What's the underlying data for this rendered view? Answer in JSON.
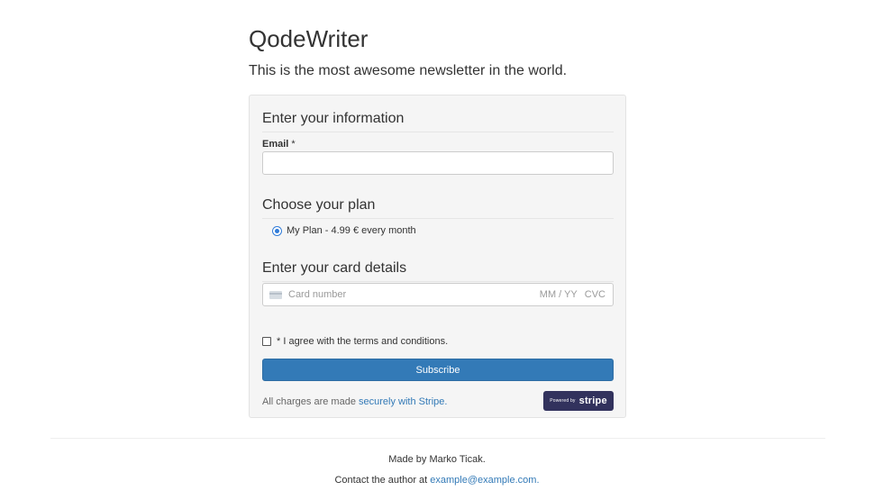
{
  "header": {
    "title": "QodeWriter",
    "tagline": "This is the most awesome newsletter in the world."
  },
  "form": {
    "info_heading": "Enter your information",
    "email_label": "Email",
    "required_mark": "*",
    "email_value": "",
    "plan_heading": "Choose your plan",
    "plan_option": "My Plan - 4.99 € every month",
    "plan_selected": true,
    "card_heading": "Enter your card details",
    "card_placeholder": "Card number",
    "card_expiry_placeholder": "MM / YY",
    "card_cvc_placeholder": "CVC",
    "terms_label": "* I agree with the terms and conditions.",
    "terms_checked": false,
    "subscribe_label": "Subscribe",
    "charges_prefix": "All charges are made ",
    "charges_link": "securely with Stripe.",
    "stripe_badge_small": "Powered by",
    "stripe_badge_brand": "stripe"
  },
  "footer": {
    "made_by": "Made by Marko Ticak.",
    "contact_prefix": "Contact the author at ",
    "contact_email": "example@example.com."
  },
  "colors": {
    "accent": "#337ab7",
    "panel_bg": "#f5f5f5",
    "stripe_badge_bg": "#32325d"
  },
  "icons": [
    "radio-selected-icon",
    "credit-card-icon",
    "checkbox-icon"
  ]
}
